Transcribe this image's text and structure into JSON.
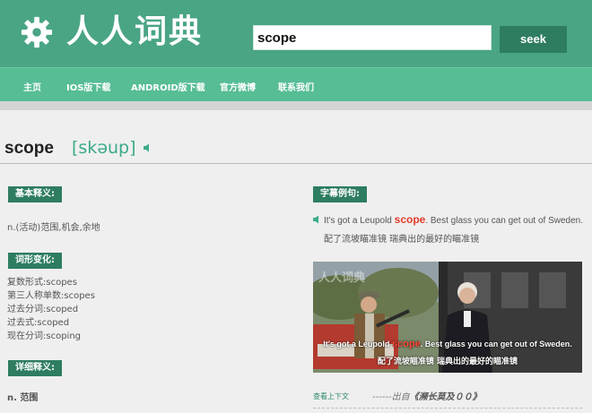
{
  "header": {
    "site_title": "人人词典",
    "search_value": "scope",
    "seek_label": "seek"
  },
  "nav": {
    "items": [
      {
        "label": "主页"
      },
      {
        "label": "IOS版下载"
      },
      {
        "label": "ANDROID版下载"
      },
      {
        "label": "官方微博"
      },
      {
        "label": "联系我们"
      }
    ]
  },
  "entry": {
    "word": "scope",
    "phonetic": "[skəup]"
  },
  "basic": {
    "tag": "基本释义:",
    "definition": "n.(活动)范围,机会,余地"
  },
  "forms": {
    "tag": "词形变化:",
    "items": [
      "复数形式:scopes",
      "第三人称单数:scopes",
      "过去分词:scoped",
      "过去式:scoped",
      "现在分词:scoping"
    ]
  },
  "detail": {
    "tag": "详细释义:",
    "first": "n. 范围"
  },
  "subtitle_example": {
    "tag": "字幕例句:",
    "en_before": "It's got a Leupold ",
    "en_highlight": "scope",
    "en_after": ". Best glass you can get out of Sweden.",
    "cn": "配了流坡瞄准镜 瑞典出的最好的瞄准镜",
    "video_watermark": "人人词典",
    "context_link": "查看上下文",
    "source_dashes": "------出自",
    "source_title": "《濒长莫及００》"
  },
  "colors": {
    "header_bg": "#4aa584",
    "nav_bg": "#56bd95",
    "tag_bg": "#2e7d61",
    "phonetic": "#3bab8b",
    "highlight": "#e53c2b"
  }
}
